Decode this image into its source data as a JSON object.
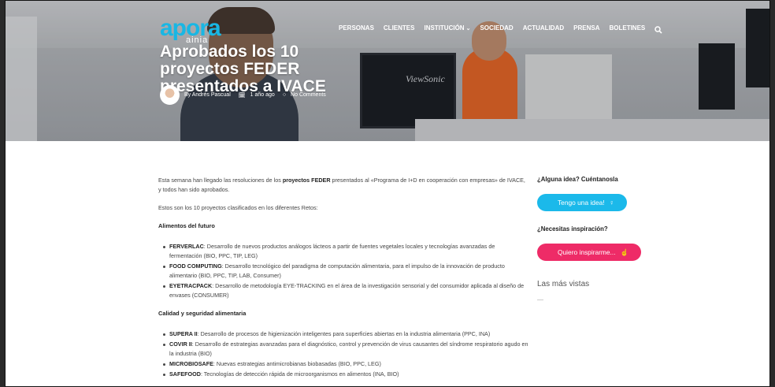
{
  "brand": {
    "logo": "apora",
    "logo_sub": "ainia",
    "accent": "#18b7e4",
    "pink": "#ee2b67"
  },
  "nav": {
    "items": [
      "PERSONAS",
      "CLIENTES",
      "INSTITUCIÓN",
      "SOCIEDAD",
      "ACTUALIDAD",
      "PRENSA",
      "BOLETINES"
    ],
    "dropdown_item": "INSTITUCIÓN",
    "search_icon": "search-icon"
  },
  "hero": {
    "title": "Aprobados los 10 proyectos FEDER presentados a IVACE",
    "monitor_brand": "ViewSonic",
    "author": "By Andrés Pascual",
    "time": "1 año ago",
    "comments": "No Comments"
  },
  "article": {
    "intro_pre": "Esta semana han llegado las resoluciones de los ",
    "intro_bold": "proyectos FEDER",
    "intro_post": " presentados al «Programa de I+D en cooperación con empresas» de IVACE, y todos han sido aprobados.",
    "intro2": "Estos son los 10 proyectos clasificados en los diferentes Retos:",
    "section1": "Alimentos del futuro",
    "items1": [
      {
        "name": "FERVERLAC",
        "desc": ": Desarrollo de nuevos productos análogos lácteos a partir de fuentes vegetales locales y tecnologías avanzadas de fermentación (BIO, PPC, TIP, LEG)"
      },
      {
        "name": "FOOD COMPUTING",
        "desc": ": Desarrollo tecnológico del paradigma de computación alimentaria, para el impulso de la innovación de producto alimentario (BIO, PPC, TIP, LAB, Consumer)"
      },
      {
        "name": "EYETRACPACK",
        "desc": ": Desarrollo de metodología EYE-TRACKING en el área de la investigación sensorial y del consumidor aplicada al diseño de envases (CONSUMER)"
      }
    ],
    "section2": "Calidad y seguridad alimentaria",
    "items2": [
      {
        "name": "SUPERA II",
        "desc": ": Desarrollo de procesos de higienización inteligentes para superficies abiertas en la industria alimentaria (PPC, INA)"
      },
      {
        "name": "COVIR II",
        "desc": ": Desarrollo de estrategias avanzadas para el diagnóstico, control y prevención de virus causantes del síndrome respiratorio agudo en la industria (BIO)"
      },
      {
        "name": "MICROBIOSAFE",
        "desc": ": Nuevas estrategias antimicrobianas biobasadas (BIO, PPC, LEG)"
      },
      {
        "name": "SAFEFOOD",
        "desc": ": Tecnologías de detección rápida de microorganismos en alimentos (INA, BIO)"
      }
    ]
  },
  "sidebar": {
    "idea_heading": "¿Alguna idea? Cuéntanosla",
    "idea_button": "Tengo una idea!",
    "inspire_heading": "¿Necesitas inspiración?",
    "inspire_button": "Quiero inspirarme...",
    "popular_heading": "Las más vistas"
  }
}
